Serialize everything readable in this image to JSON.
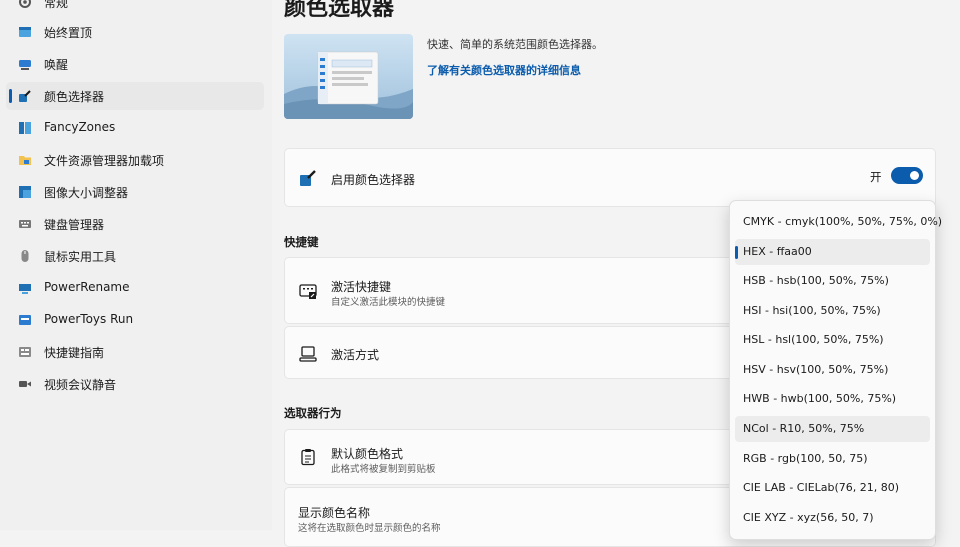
{
  "sidebar": {
    "items": [
      {
        "label": "常规",
        "icon": "gear-icon"
      },
      {
        "label": "始终置顶",
        "icon": "pin-window-icon"
      },
      {
        "label": "唤醒",
        "icon": "coffee-cup-icon"
      },
      {
        "label": "颜色选择器",
        "icon": "color-picker-icon",
        "selected": true
      },
      {
        "label": "FancyZones",
        "icon": "fancyzones-icon"
      },
      {
        "label": "文件资源管理器加载项",
        "icon": "folder-icon"
      },
      {
        "label": "图像大小调整器",
        "icon": "image-resize-icon"
      },
      {
        "label": "键盘管理器",
        "icon": "keyboard-icon"
      },
      {
        "label": "鼠标实用工具",
        "icon": "mouse-icon"
      },
      {
        "label": "PowerRename",
        "icon": "powerrename-icon"
      },
      {
        "label": "PowerToys Run",
        "icon": "powertoys-run-icon"
      },
      {
        "label": "快捷键指南",
        "icon": "shortcut-guide-icon"
      },
      {
        "label": "视频会议静音",
        "icon": "video-conference-icon"
      }
    ]
  },
  "main": {
    "title": "颜色选取器",
    "description": "快速、简单的系统范围颜色选择器。",
    "learn_more": "了解有关颜色选取器的详细信息",
    "enable_card": {
      "title": "启用颜色选择器",
      "toggle_state": "开"
    },
    "shortcut_section": "快捷键",
    "activation_shortcut": {
      "title": "激活快捷键",
      "subtitle": "自定义激活此模块的快捷键"
    },
    "activation_behavior": {
      "title": "激活方式"
    },
    "picker_section": "选取器行为",
    "default_format": {
      "title": "默认颜色格式",
      "subtitle": "此格式将被复制到剪贴板"
    },
    "show_name": {
      "title": "显示颜色名称",
      "subtitle": "这将在选取颜色时显示颜色的名称"
    }
  },
  "dropdown": {
    "options": [
      "CMYK - cmyk(100%, 50%, 75%, 0%)",
      "HEX - ffaa00",
      "HSB - hsb(100, 50%, 75%)",
      "HSI - hsi(100, 50%, 75%)",
      "HSL - hsl(100, 50%, 75%)",
      "HSV - hsv(100, 50%, 75%)",
      "HWB - hwb(100, 50%, 75%)",
      "NCol - R10, 50%, 75%",
      "RGB - rgb(100, 50, 75)",
      "CIE LAB - CIELab(76, 21, 80)",
      "CIE XYZ - xyz(56, 50, 7)"
    ],
    "selected": "HEX - ffaa00",
    "hovered": "NCol - R10, 50%, 75%"
  },
  "colors": {
    "accent": "#0b5cad",
    "background": "#f3f3f3",
    "card": "#fbfbfb"
  }
}
